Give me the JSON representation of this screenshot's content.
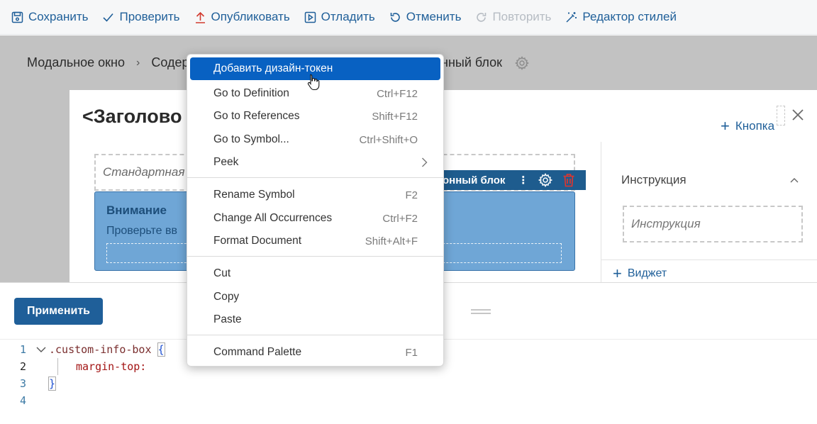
{
  "toolbar": {
    "save": "Сохранить",
    "check": "Проверить",
    "publish": "Опубликовать",
    "debug": "Отладить",
    "undo": "Отменить",
    "redo": "Повторить",
    "style_editor": "Редактор стилей"
  },
  "breadcrumb": {
    "item1": "Модальное окно",
    "item2": "Содер",
    "item3": "нный блок"
  },
  "modal": {
    "title": "<Заголово",
    "add_button": "Кнопка",
    "standard_field": "Стандартная ф",
    "selection_label": "онный блок",
    "info_title": "Внимание",
    "info_text": "Проверьте вв"
  },
  "side_panel": {
    "label": "Инструкция",
    "input_placeholder": "Инструкция",
    "add_widget": "Виджет"
  },
  "apply_button": "Применить",
  "code": {
    "line_numbers": [
      "1",
      "2",
      "3",
      "4"
    ],
    "selector": ".custom-info-box",
    "open_brace": "{",
    "property": "margin-top:",
    "close_brace": "}"
  },
  "context_menu": {
    "items": [
      {
        "label": "Добавить дизайн-токен",
        "shortcut": ""
      },
      {
        "label": "Go to Definition",
        "shortcut": "Ctrl+F12"
      },
      {
        "label": "Go to References",
        "shortcut": "Shift+F12"
      },
      {
        "label": "Go to Symbol...",
        "shortcut": "Ctrl+Shift+O"
      },
      {
        "label": "Peek",
        "shortcut": ""
      },
      {
        "label": "Rename Symbol",
        "shortcut": "F2"
      },
      {
        "label": "Change All Occurrences",
        "shortcut": "Ctrl+F2"
      },
      {
        "label": "Format Document",
        "shortcut": "Shift+Alt+F"
      },
      {
        "label": "Cut",
        "shortcut": ""
      },
      {
        "label": "Copy",
        "shortcut": ""
      },
      {
        "label": "Paste",
        "shortcut": ""
      },
      {
        "label": "Command Palette",
        "shortcut": "F1"
      }
    ]
  },
  "colors": {
    "accent": "#1f5f99",
    "highlight": "#0861c2",
    "danger": "#d23b2f",
    "info_block": "#6fa6d6"
  }
}
